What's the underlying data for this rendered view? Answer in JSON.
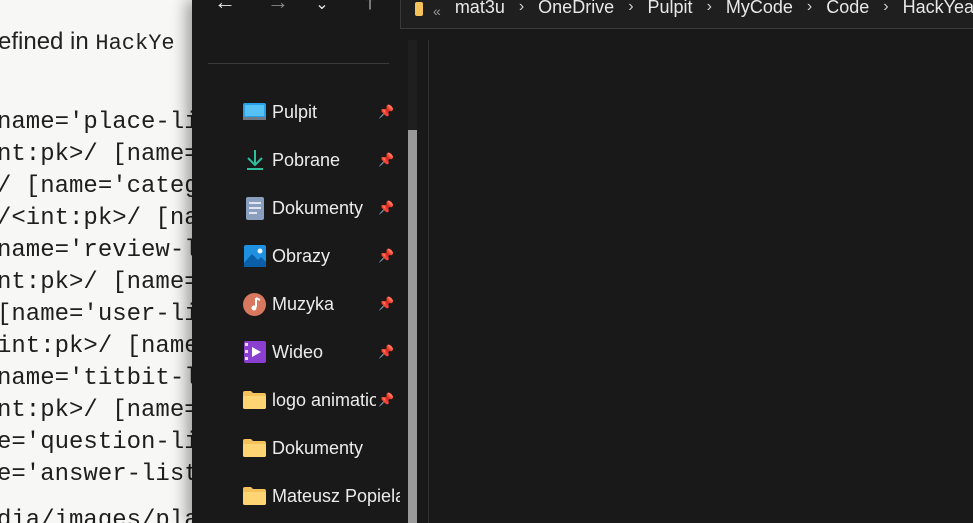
{
  "background_page": {
    "heading_text": "efined in ",
    "heading_code": "HackYe",
    "code_lines": [
      "name='place-lis",
      "nt:pk>/ [name=",
      "/ [name='categ",
      "/<int:pk>/ [na",
      "name='review-l",
      "nt:pk>/ [name=",
      "[name='user-li",
      "int:pk>/ [name",
      "name='titbit-l",
      "nt:pk>/ [name=",
      "e='question-li",
      "e='answer-list"
    ],
    "tail_line": "dia/images/pla"
  },
  "toolbar": {
    "back_icon": "←",
    "forward_icon": "→",
    "recent_icon": "⌄",
    "up_icon": "↑"
  },
  "address_bar": {
    "overflow_chevron": "«",
    "crumbs": [
      "mat3u",
      "OneDrive",
      "Pulpit",
      "MyCode",
      "Code",
      "HackYea"
    ],
    "separator": "›"
  },
  "sidebar": {
    "items": [
      {
        "label": "Pulpit",
        "icon": "desktop-icon",
        "pinned": true
      },
      {
        "label": "Pobrane",
        "icon": "download-icon",
        "pinned": true
      },
      {
        "label": "Dokumenty",
        "icon": "document-icon",
        "pinned": true
      },
      {
        "label": "Obrazy",
        "icon": "pictures-icon",
        "pinned": true
      },
      {
        "label": "Muzyka",
        "icon": "music-icon",
        "pinned": true
      },
      {
        "label": "Wideo",
        "icon": "video-icon",
        "pinned": true
      },
      {
        "label": "logo animation",
        "icon": "folder-icon",
        "pinned": true
      },
      {
        "label": "Dokumenty",
        "icon": "folder-icon",
        "pinned": false
      },
      {
        "label": "Mateusz Popiela",
        "icon": "folder-icon",
        "pinned": false
      }
    ],
    "pin_glyph": "📌"
  },
  "colors": {
    "window_bg": "#191919",
    "folder_yellow": "#f4c25a",
    "accent_blue": "#1f8fe0"
  }
}
